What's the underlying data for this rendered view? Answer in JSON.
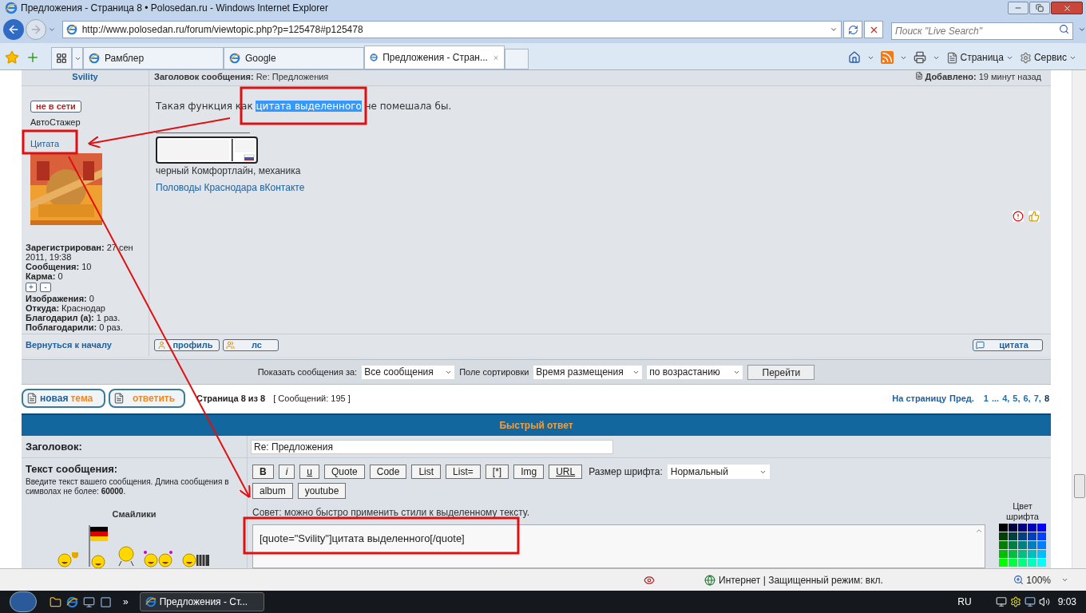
{
  "window": {
    "title": "Предложения - Страница 8 • Polosedan.ru - Windows Internet Explorer"
  },
  "address_bar": {
    "url": "http://www.polosedan.ru/forum/viewtopic.php?p=125478#p125478"
  },
  "search": {
    "placeholder": "Поиск \"Live Search\""
  },
  "tabs": [
    {
      "label": "Рамблер",
      "selected": false
    },
    {
      "label": "Google",
      "selected": false
    },
    {
      "label": "Предложения - Стран...",
      "selected": true
    }
  ],
  "command_bar": [
    {
      "label": "Страница",
      "kind": "page"
    },
    {
      "label": "Сервис",
      "kind": "tools"
    }
  ],
  "post": {
    "author": "Svility",
    "subject_label": "Заголовок сообщения:",
    "subject": "Re: Предложения",
    "posted_label": "Добавлено:",
    "posted": "19 минут назад",
    "status": "не в сети",
    "rank": "АвтоСтажер",
    "quote_link": "Цитата",
    "stats": [
      {
        "label": "Зарегистрирован:",
        "value": "27 сен 2011, 19:38",
        "kind": "plain"
      },
      {
        "label": "Сообщения:",
        "value": "10",
        "kind": "plain"
      },
      {
        "label": "Карма:",
        "value": "0",
        "kind": "karma"
      },
      {
        "label": "Изображения:",
        "value": "0",
        "kind": "plain"
      },
      {
        "label": "Откуда:",
        "value": "Краснодар",
        "kind": "plain"
      },
      {
        "label": "Благодарил (а):",
        "value": "1 раз.",
        "kind": "plain"
      },
      {
        "label": "Поблагодарили:",
        "value": "0 раз.",
        "kind": "plain"
      }
    ],
    "karma_buttons": [
      "+",
      "-"
    ],
    "segments": [
      {
        "text": "Такая функция как ",
        "selected": false
      },
      {
        "text": "цитата выделенного",
        "selected": true
      },
      {
        "text": " не помешала бы.",
        "selected": false
      }
    ],
    "signature": "черный Комфортлайн, механика",
    "signature_link": "Половоды Краснодара вКонтакте",
    "back_to_top": "Вернуться к началу",
    "buttons": [
      {
        "label": "профиль",
        "kind": "profile"
      },
      {
        "label": "лс",
        "kind": "pm"
      }
    ],
    "quote_button": "цитата"
  },
  "sort_bar": {
    "show_label": "Показать сообщения за:",
    "show_value": "Все сообщения",
    "sort_label": "Поле сортировки",
    "sort_value": "Время размещения",
    "order_value": "по возрастанию",
    "go": "Перейти"
  },
  "topic_actions": {
    "new_topic": [
      "новая",
      "тема"
    ],
    "reply": "ответить",
    "page_info": "Страница 8 из 8",
    "count": "[ Сообщений: 195 ]",
    "pagination_label": "На страницу",
    "prev": "Пред.",
    "pages": [
      {
        "text": "1",
        "selected": false
      },
      {
        "text": "...",
        "selected": false
      },
      {
        "text": "4,",
        "selected": false
      },
      {
        "text": "5,",
        "selected": false
      },
      {
        "text": "6,",
        "selected": false
      },
      {
        "text": "7,",
        "selected": false
      },
      {
        "text": "8",
        "selected": true
      }
    ]
  },
  "quick_reply": {
    "title": "Быстрый ответ",
    "subject_label": "Заголовок:",
    "subject_value": "Re: Предложения",
    "text_label": "Текст сообщения:",
    "text_hint": "Введите текст вашего сообщения. Длина сообщения в символах не более: **60000**.",
    "smilies_label": "Смайлики",
    "smilies": [
      {
        "kind": "cup"
      },
      {
        "kind": "flag"
      },
      {
        "kind": "plain"
      },
      {
        "kind": "pair"
      },
      {
        "kind": "accordion"
      }
    ],
    "toolbar": [
      {
        "label": "B",
        "kind": "bold"
      },
      {
        "label": "i",
        "kind": "italic"
      },
      {
        "label": "u",
        "kind": "underline"
      },
      {
        "label": "Quote",
        "kind": "plain"
      },
      {
        "label": "Code",
        "kind": "plain"
      },
      {
        "label": "List",
        "kind": "plain"
      },
      {
        "label": "List=",
        "kind": "plain"
      },
      {
        "label": "[*]",
        "kind": "plain"
      },
      {
        "label": "Img",
        "kind": "plain"
      },
      {
        "label": "URL",
        "kind": "underline"
      }
    ],
    "toolbar_row2": [
      "album",
      "youtube"
    ],
    "font_size_label": "Размер шрифта:",
    "font_size": "Нормальный",
    "tip": "Совет: можно быстро применить стили к выделенному тексту.",
    "message": "[quote=\"Svility\"]цитата выделенного[/quote]",
    "palette_label": "Цвет шрифта",
    "swatches": [
      {
        "color": "#000000"
      },
      {
        "color": "#000040"
      },
      {
        "color": "#000080"
      },
      {
        "color": "#0000bf"
      },
      {
        "color": "#0000ff"
      },
      {
        "color": "#004000"
      },
      {
        "color": "#004040"
      },
      {
        "color": "#004080"
      },
      {
        "color": "#0040bf"
      },
      {
        "color": "#0040ff"
      },
      {
        "color": "#008000"
      },
      {
        "color": "#008040"
      },
      {
        "color": "#008080"
      },
      {
        "color": "#0080bf"
      },
      {
        "color": "#0080ff"
      },
      {
        "color": "#00bf00"
      },
      {
        "color": "#00bf40"
      },
      {
        "color": "#00bf80"
      },
      {
        "color": "#00bfbf"
      },
      {
        "color": "#00bfff"
      },
      {
        "color": "#00ff00"
      },
      {
        "color": "#00ff40"
      },
      {
        "color": "#00ff80"
      },
      {
        "color": "#00ffbf"
      },
      {
        "color": "#00ffff"
      }
    ]
  },
  "status_bar": {
    "zone": "Интернет | Защищенный режим: вкл.",
    "zoom": "100%"
  },
  "taskbar": {
    "more": "»",
    "task": "Предложения - Ст...",
    "language": "RU",
    "clock": "9:03"
  }
}
